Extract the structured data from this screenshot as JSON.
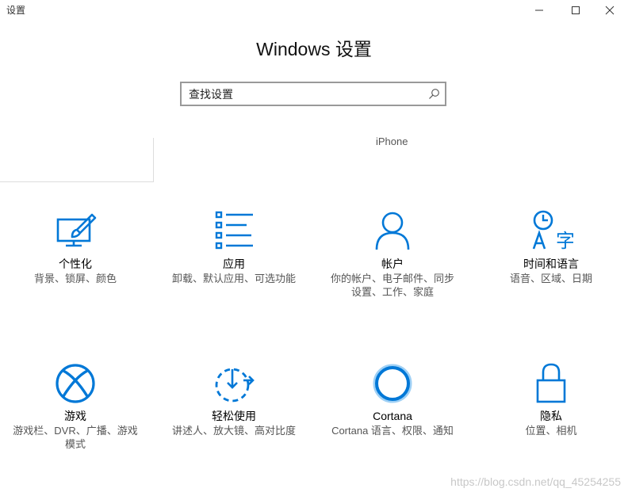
{
  "window": {
    "title": "设置",
    "minimize_label": "minimize",
    "maximize_label": "maximize",
    "close_label": "close"
  },
  "header": {
    "title": "Windows 设置"
  },
  "search": {
    "placeholder": "查找设置"
  },
  "partial_row": {
    "right_label": "iPhone"
  },
  "tiles": [
    {
      "name": "个性化",
      "desc": "背景、锁屏、颜色",
      "icon": "personalization-icon"
    },
    {
      "name": "应用",
      "desc": "卸载、默认应用、可选功能",
      "icon": "apps-icon"
    },
    {
      "name": "帐户",
      "desc": "你的帐户、电子邮件、同步设置、工作、家庭",
      "icon": "account-icon"
    },
    {
      "name": "时间和语言",
      "desc": "语音、区域、日期",
      "icon": "time-language-icon"
    },
    {
      "name": "游戏",
      "desc": "游戏栏、DVR、广播、游戏模式",
      "icon": "xbox-icon"
    },
    {
      "name": "轻松使用",
      "desc": "讲述人、放大镜、高对比度",
      "icon": "ease-of-access-icon"
    },
    {
      "name": "Cortana",
      "desc": "Cortana 语言、权限、通知",
      "icon": "cortana-icon"
    },
    {
      "name": "隐私",
      "desc": "位置、相机",
      "icon": "lock-icon"
    }
  ],
  "watermark": "https://blog.csdn.net/qq_45254255",
  "colors": {
    "accent": "#0078d7"
  }
}
